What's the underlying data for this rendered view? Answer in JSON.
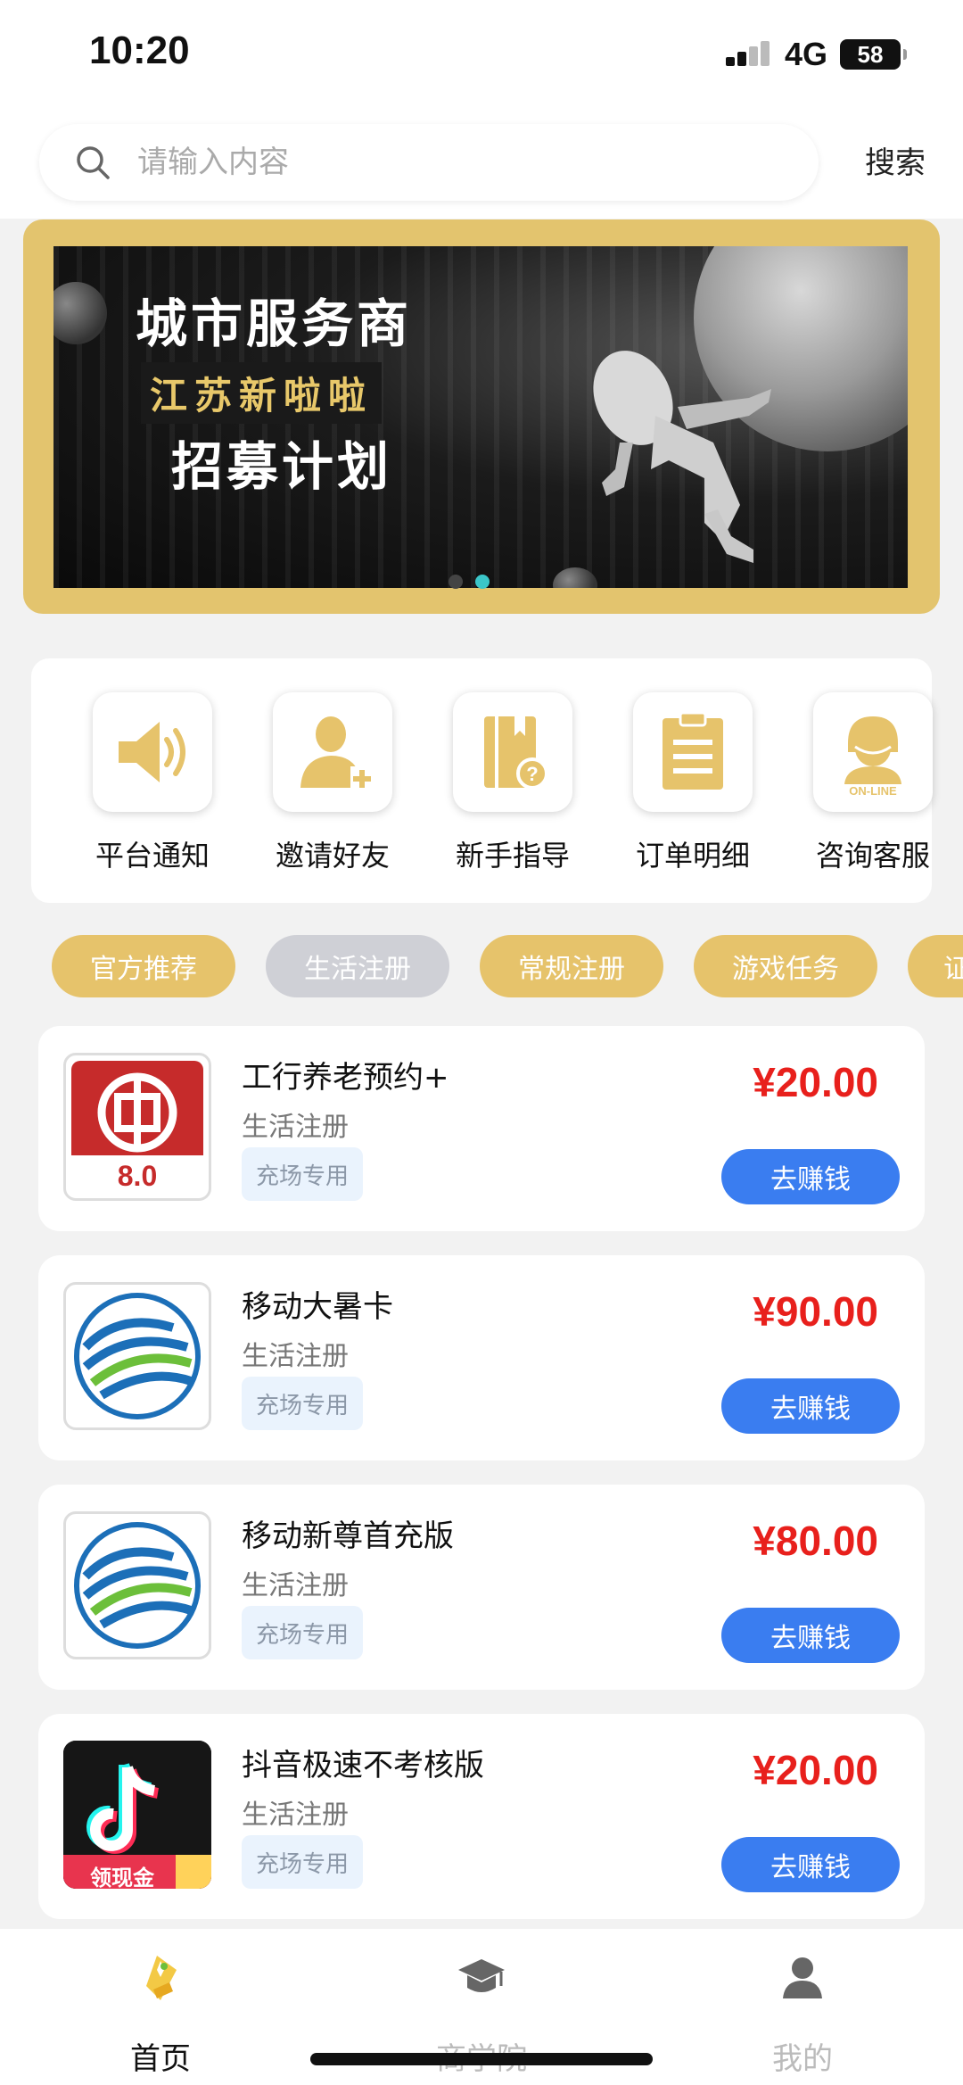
{
  "status_bar": {
    "time": "10:20",
    "network": "4G",
    "battery": "58"
  },
  "search": {
    "placeholder": "请输入内容",
    "button_label": "搜索"
  },
  "banner": {
    "title": "城市服务商",
    "subtitle": "江苏新啦啦",
    "subtitle2": "招募计划",
    "accent_color": "#e3c46e",
    "slides_total": 2,
    "active_slide": 2
  },
  "quick_actions": [
    {
      "label": "平台通知",
      "icon": "speaker-icon"
    },
    {
      "label": "邀请好友",
      "icon": "add-user-icon"
    },
    {
      "label": "新手指导",
      "icon": "guide-book-icon"
    },
    {
      "label": "订单明细",
      "icon": "clipboard-icon"
    },
    {
      "label": "咨询客服",
      "icon": "customer-service-icon"
    }
  ],
  "tags": [
    {
      "label": "官方推荐",
      "active": true
    },
    {
      "label": "生活注册",
      "active": false
    },
    {
      "label": "常规注册",
      "active": true
    },
    {
      "label": "游戏任务",
      "active": true
    },
    {
      "label": "证",
      "active": true
    }
  ],
  "tasks": [
    {
      "name": "工行养老预约+",
      "category": "生活注册",
      "badge": "充场专用",
      "price": "¥20.00",
      "button": "去赚钱",
      "logo": "icbc-logo"
    },
    {
      "name": "移动大暑卡",
      "category": "生活注册",
      "badge": "充场专用",
      "price": "¥90.00",
      "button": "去赚钱",
      "logo": "china-mobile-logo"
    },
    {
      "name": "移动新尊首充版",
      "category": "生活注册",
      "badge": "充场专用",
      "price": "¥80.00",
      "button": "去赚钱",
      "logo": "china-mobile-logo"
    },
    {
      "name": "抖音极速不考核版",
      "category": "生活注册",
      "badge": "充场专用",
      "price": "¥20.00",
      "button": "去赚钱",
      "logo": "douyin-logo",
      "logo_caption": "领现金"
    }
  ],
  "bottom_nav": [
    {
      "label": "首页",
      "icon": "home-icon",
      "active": true
    },
    {
      "label": "商学院",
      "icon": "graduation-cap-icon",
      "active": false
    },
    {
      "label": "我的",
      "icon": "user-icon",
      "active": false
    }
  ],
  "colors": {
    "gold": "#e6c36b",
    "price_red": "#e8201c",
    "button_blue": "#3a7df0",
    "tag_inactive": "#cfd0d6"
  }
}
